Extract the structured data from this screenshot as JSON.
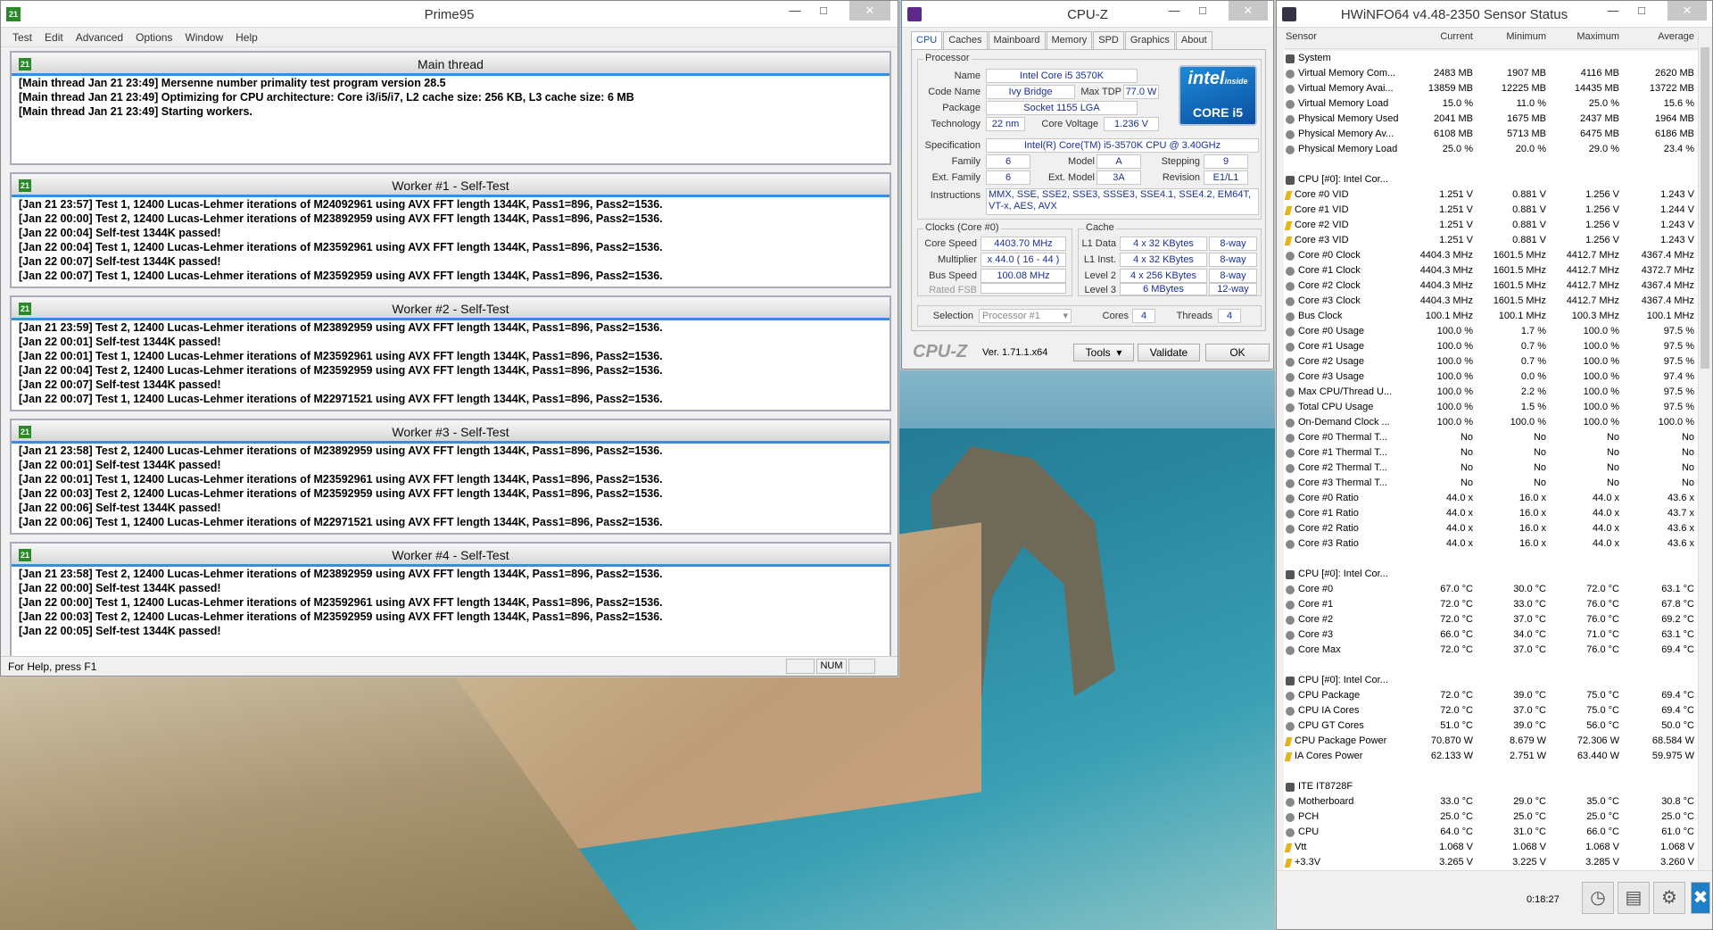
{
  "prime95": {
    "title": "Prime95",
    "menu": [
      "Test",
      "Edit",
      "Advanced",
      "Options",
      "Window",
      "Help"
    ],
    "main": {
      "title": "Main thread",
      "lines": [
        "[Main thread Jan 21 23:49] Mersenne number primality test program version 28.5",
        "[Main thread Jan 21 23:49] Optimizing for CPU architecture: Core i3/i5/i7, L2 cache size: 256 KB, L3 cache size: 6 MB",
        "[Main thread Jan 21 23:49] Starting workers."
      ]
    },
    "workers": [
      {
        "title": "Worker #1 - Self-Test",
        "lines": [
          "[Jan 21 23:57] Test 1, 12400 Lucas-Lehmer iterations of M24092961 using AVX FFT length 1344K, Pass1=896, Pass2=1536.",
          "[Jan 22 00:00] Test 2, 12400 Lucas-Lehmer iterations of M23892959 using AVX FFT length 1344K, Pass1=896, Pass2=1536.",
          "[Jan 22 00:04] Self-test 1344K passed!",
          "[Jan 22 00:04] Test 1, 12400 Lucas-Lehmer iterations of M23592961 using AVX FFT length 1344K, Pass1=896, Pass2=1536.",
          "[Jan 22 00:07] Self-test 1344K passed!",
          "[Jan 22 00:07] Test 1, 12400 Lucas-Lehmer iterations of M23592959 using AVX FFT length 1344K, Pass1=896, Pass2=1536."
        ]
      },
      {
        "title": "Worker #2 - Self-Test",
        "lines": [
          "[Jan 21 23:59] Test 2, 12400 Lucas-Lehmer iterations of M23892959 using AVX FFT length 1344K, Pass1=896, Pass2=1536.",
          "[Jan 22 00:01] Self-test 1344K passed!",
          "[Jan 22 00:01] Test 1, 12400 Lucas-Lehmer iterations of M23592961 using AVX FFT length 1344K, Pass1=896, Pass2=1536.",
          "[Jan 22 00:04] Test 2, 12400 Lucas-Lehmer iterations of M23592959 using AVX FFT length 1344K, Pass1=896, Pass2=1536.",
          "[Jan 22 00:07] Self-test 1344K passed!",
          "[Jan 22 00:07] Test 1, 12400 Lucas-Lehmer iterations of M22971521 using AVX FFT length 1344K, Pass1=896, Pass2=1536."
        ]
      },
      {
        "title": "Worker #3 - Self-Test",
        "lines": [
          "[Jan 21 23:58] Test 2, 12400 Lucas-Lehmer iterations of M23892959 using AVX FFT length 1344K, Pass1=896, Pass2=1536.",
          "[Jan 22 00:01] Self-test 1344K passed!",
          "[Jan 22 00:01] Test 1, 12400 Lucas-Lehmer iterations of M23592961 using AVX FFT length 1344K, Pass1=896, Pass2=1536.",
          "[Jan 22 00:03] Test 2, 12400 Lucas-Lehmer iterations of M23592959 using AVX FFT length 1344K, Pass1=896, Pass2=1536.",
          "[Jan 22 00:06] Self-test 1344K passed!",
          "[Jan 22 00:06] Test 1, 12400 Lucas-Lehmer iterations of M22971521 using AVX FFT length 1344K, Pass1=896, Pass2=1536."
        ]
      },
      {
        "title": "Worker #4 - Self-Test",
        "lines": [
          "[Jan 21 23:58] Test 2, 12400 Lucas-Lehmer iterations of M23892959 using AVX FFT length 1344K, Pass1=896, Pass2=1536.",
          "[Jan 22 00:00] Self-test 1344K passed!",
          "[Jan 22 00:00] Test 1, 12400 Lucas-Lehmer iterations of M23592961 using AVX FFT length 1344K, Pass1=896, Pass2=1536.",
          "[Jan 22 00:03] Test 2, 12400 Lucas-Lehmer iterations of M23592959 using AVX FFT length 1344K, Pass1=896, Pass2=1536.",
          "[Jan 22 00:05] Self-test 1344K passed!"
        ]
      }
    ],
    "status_help": "For Help, press F1",
    "status_num": "NUM"
  },
  "cpuz": {
    "title": "CPU-Z",
    "tabs": [
      "CPU",
      "Caches",
      "Mainboard",
      "Memory",
      "SPD",
      "Graphics",
      "About"
    ],
    "processor_label": "Processor",
    "name_label": "Name",
    "name": "Intel Core i5 3570K",
    "codename_label": "Code Name",
    "codename": "Ivy Bridge",
    "maxtdp_label": "Max TDP",
    "maxtdp": "77.0 W",
    "package_label": "Package",
    "package": "Socket 1155 LGA",
    "technology_label": "Technology",
    "technology": "22 nm",
    "corevoltage_label": "Core Voltage",
    "corevoltage": "1.236 V",
    "spec_label": "Specification",
    "spec": "Intel(R) Core(TM) i5-3570K CPU @ 3.40GHz",
    "family_label": "Family",
    "family": "6",
    "model_label": "Model",
    "model": "A",
    "stepping_label": "Stepping",
    "stepping": "9",
    "extfamily_label": "Ext. Family",
    "extfamily": "6",
    "extmodel_label": "Ext. Model",
    "extmodel": "3A",
    "revision_label": "Revision",
    "revision": "E1/L1",
    "instructions_label": "Instructions",
    "instructions": "MMX, SSE, SSE2, SSE3, SSSE3, SSE4.1, SSE4.2, EM64T, VT-x, AES, AVX",
    "logo_line1": "intel",
    "logo_line2": "inside",
    "logo_line3": "CORE i5",
    "clocks_label": "Clocks (Core #0)",
    "corespeed_label": "Core Speed",
    "corespeed": "4403.70 MHz",
    "multiplier_label": "Multiplier",
    "multiplier": "x 44.0 ( 16 - 44 )",
    "busspeed_label": "Bus Speed",
    "busspeed": "100.08 MHz",
    "ratedfsb_label": "Rated FSB",
    "ratedfsb": "",
    "cache_label": "Cache",
    "l1d_label": "L1 Data",
    "l1d": "4 x 32 KBytes",
    "l1d_way": "8-way",
    "l1i_label": "L1 Inst.",
    "l1i": "4 x 32 KBytes",
    "l1i_way": "8-way",
    "l2_label": "Level 2",
    "l2": "4 x 256 KBytes",
    "l2_way": "8-way",
    "l3_label": "Level 3",
    "l3": "6 MBytes",
    "l3_way": "12-way",
    "selection_label": "Selection",
    "selection": "Processor #1",
    "cores_label": "Cores",
    "cores": "4",
    "threads_label": "Threads",
    "threads": "4",
    "brand": "CPU-Z",
    "version": "Ver. 1.71.1.x64",
    "tools_label": "Tools",
    "validate_label": "Validate",
    "ok_label": "OK"
  },
  "hwinfo": {
    "title": "HWiNFO64 v4.48-2350 Sensor Status",
    "columns": [
      "Sensor",
      "Current",
      "Minimum",
      "Maximum",
      "Average"
    ],
    "rows": [
      {
        "t": "h",
        "n": "System"
      },
      {
        "t": "c",
        "n": "Virtual Memory Com...",
        "v": [
          "2483 MB",
          "1907 MB",
          "4116 MB",
          "2620 MB"
        ]
      },
      {
        "t": "c",
        "n": "Virtual Memory Avai...",
        "v": [
          "13859 MB",
          "12225 MB",
          "14435 MB",
          "13722 MB"
        ]
      },
      {
        "t": "c",
        "n": "Virtual Memory Load",
        "v": [
          "15.0 %",
          "11.0 %",
          "25.0 %",
          "15.6 %"
        ]
      },
      {
        "t": "c",
        "n": "Physical Memory Used",
        "v": [
          "2041 MB",
          "1675 MB",
          "2437 MB",
          "1964 MB"
        ]
      },
      {
        "t": "c",
        "n": "Physical Memory Av...",
        "v": [
          "6108 MB",
          "5713 MB",
          "6475 MB",
          "6186 MB"
        ]
      },
      {
        "t": "c",
        "n": "Physical Memory Load",
        "v": [
          "25.0 %",
          "20.0 %",
          "29.0 %",
          "23.4 %"
        ]
      },
      {
        "t": "s"
      },
      {
        "t": "h",
        "n": "CPU [#0]: Intel Cor..."
      },
      {
        "t": "b",
        "n": "Core #0 VID",
        "v": [
          "1.251 V",
          "0.881 V",
          "1.256 V",
          "1.243 V"
        ]
      },
      {
        "t": "b",
        "n": "Core #1 VID",
        "v": [
          "1.251 V",
          "0.881 V",
          "1.256 V",
          "1.244 V"
        ]
      },
      {
        "t": "b",
        "n": "Core #2 VID",
        "v": [
          "1.251 V",
          "0.881 V",
          "1.256 V",
          "1.243 V"
        ]
      },
      {
        "t": "b",
        "n": "Core #3 VID",
        "v": [
          "1.251 V",
          "0.881 V",
          "1.256 V",
          "1.243 V"
        ]
      },
      {
        "t": "c",
        "n": "Core #0 Clock",
        "v": [
          "4404.3 MHz",
          "1601.5 MHz",
          "4412.7 MHz",
          "4367.4 MHz"
        ]
      },
      {
        "t": "c",
        "n": "Core #1 Clock",
        "v": [
          "4404.3 MHz",
          "1601.5 MHz",
          "4412.7 MHz",
          "4372.7 MHz"
        ]
      },
      {
        "t": "c",
        "n": "Core #2 Clock",
        "v": [
          "4404.3 MHz",
          "1601.5 MHz",
          "4412.7 MHz",
          "4367.4 MHz"
        ]
      },
      {
        "t": "c",
        "n": "Core #3 Clock",
        "v": [
          "4404.3 MHz",
          "1601.5 MHz",
          "4412.7 MHz",
          "4367.4 MHz"
        ]
      },
      {
        "t": "c",
        "n": "Bus Clock",
        "v": [
          "100.1 MHz",
          "100.1 MHz",
          "100.3 MHz",
          "100.1 MHz"
        ]
      },
      {
        "t": "c",
        "n": "Core #0 Usage",
        "v": [
          "100.0 %",
          "1.7 %",
          "100.0 %",
          "97.5 %"
        ]
      },
      {
        "t": "c",
        "n": "Core #1 Usage",
        "v": [
          "100.0 %",
          "0.7 %",
          "100.0 %",
          "97.5 %"
        ]
      },
      {
        "t": "c",
        "n": "Core #2 Usage",
        "v": [
          "100.0 %",
          "0.7 %",
          "100.0 %",
          "97.5 %"
        ]
      },
      {
        "t": "c",
        "n": "Core #3 Usage",
        "v": [
          "100.0 %",
          "0.0 %",
          "100.0 %",
          "97.4 %"
        ]
      },
      {
        "t": "c",
        "n": "Max CPU/Thread U...",
        "v": [
          "100.0 %",
          "2.2 %",
          "100.0 %",
          "97.5 %"
        ]
      },
      {
        "t": "c",
        "n": "Total CPU Usage",
        "v": [
          "100.0 %",
          "1.5 %",
          "100.0 %",
          "97.5 %"
        ]
      },
      {
        "t": "c",
        "n": "On-Demand Clock ...",
        "v": [
          "100.0 %",
          "100.0 %",
          "100.0 %",
          "100.0 %"
        ]
      },
      {
        "t": "c",
        "n": "Core #0 Thermal T...",
        "v": [
          "No",
          "No",
          "No",
          "No"
        ]
      },
      {
        "t": "c",
        "n": "Core #1 Thermal T...",
        "v": [
          "No",
          "No",
          "No",
          "No"
        ]
      },
      {
        "t": "c",
        "n": "Core #2 Thermal T...",
        "v": [
          "No",
          "No",
          "No",
          "No"
        ]
      },
      {
        "t": "c",
        "n": "Core #3 Thermal T...",
        "v": [
          "No",
          "No",
          "No",
          "No"
        ]
      },
      {
        "t": "c",
        "n": "Core #0 Ratio",
        "v": [
          "44.0 x",
          "16.0 x",
          "44.0 x",
          "43.6 x"
        ]
      },
      {
        "t": "c",
        "n": "Core #1 Ratio",
        "v": [
          "44.0 x",
          "16.0 x",
          "44.0 x",
          "43.7 x"
        ]
      },
      {
        "t": "c",
        "n": "Core #2 Ratio",
        "v": [
          "44.0 x",
          "16.0 x",
          "44.0 x",
          "43.6 x"
        ]
      },
      {
        "t": "c",
        "n": "Core #3 Ratio",
        "v": [
          "44.0 x",
          "16.0 x",
          "44.0 x",
          "43.6 x"
        ]
      },
      {
        "t": "s"
      },
      {
        "t": "h",
        "n": "CPU [#0]: Intel Cor..."
      },
      {
        "t": "c",
        "n": "Core #0",
        "v": [
          "67.0 °C",
          "30.0 °C",
          "72.0 °C",
          "63.1 °C"
        ]
      },
      {
        "t": "c",
        "n": "Core #1",
        "v": [
          "72.0 °C",
          "33.0 °C",
          "76.0 °C",
          "67.8 °C"
        ]
      },
      {
        "t": "c",
        "n": "Core #2",
        "v": [
          "72.0 °C",
          "37.0 °C",
          "76.0 °C",
          "69.2 °C"
        ]
      },
      {
        "t": "c",
        "n": "Core #3",
        "v": [
          "66.0 °C",
          "34.0 °C",
          "71.0 °C",
          "63.1 °C"
        ]
      },
      {
        "t": "c",
        "n": "Core Max",
        "v": [
          "72.0 °C",
          "37.0 °C",
          "76.0 °C",
          "69.4 °C"
        ]
      },
      {
        "t": "s"
      },
      {
        "t": "h",
        "n": "CPU [#0]: Intel Cor..."
      },
      {
        "t": "c",
        "n": "CPU Package",
        "v": [
          "72.0 °C",
          "39.0 °C",
          "75.0 °C",
          "69.4 °C"
        ]
      },
      {
        "t": "c",
        "n": "CPU IA Cores",
        "v": [
          "72.0 °C",
          "37.0 °C",
          "75.0 °C",
          "69.4 °C"
        ]
      },
      {
        "t": "c",
        "n": "CPU GT Cores",
        "v": [
          "51.0 °C",
          "39.0 °C",
          "56.0 °C",
          "50.0 °C"
        ]
      },
      {
        "t": "b",
        "n": "CPU Package Power",
        "v": [
          "70.870 W",
          "8.679 W",
          "72.306 W",
          "68.584 W"
        ]
      },
      {
        "t": "b",
        "n": "IA Cores Power",
        "v": [
          "62.133 W",
          "2.751 W",
          "63.440 W",
          "59.975 W"
        ]
      },
      {
        "t": "s"
      },
      {
        "t": "h",
        "n": "ITE IT8728F"
      },
      {
        "t": "c",
        "n": "Motherboard",
        "v": [
          "33.0 °C",
          "29.0 °C",
          "35.0 °C",
          "30.8 °C"
        ]
      },
      {
        "t": "c",
        "n": "PCH",
        "v": [
          "25.0 °C",
          "25.0 °C",
          "25.0 °C",
          "25.0 °C"
        ]
      },
      {
        "t": "c",
        "n": "CPU",
        "v": [
          "64.0 °C",
          "31.0 °C",
          "66.0 °C",
          "61.0 °C"
        ]
      },
      {
        "t": "b",
        "n": "Vtt",
        "v": [
          "1.068 V",
          "1.068 V",
          "1.068 V",
          "1.068 V"
        ]
      },
      {
        "t": "b",
        "n": "+3.3V",
        "v": [
          "3.265 V",
          "3.225 V",
          "3.285 V",
          "3.260 V"
        ]
      }
    ],
    "elapsed": "0:18:27",
    "icons": [
      "clock-icon",
      "report-icon",
      "settings-icon",
      "close-icon"
    ]
  }
}
